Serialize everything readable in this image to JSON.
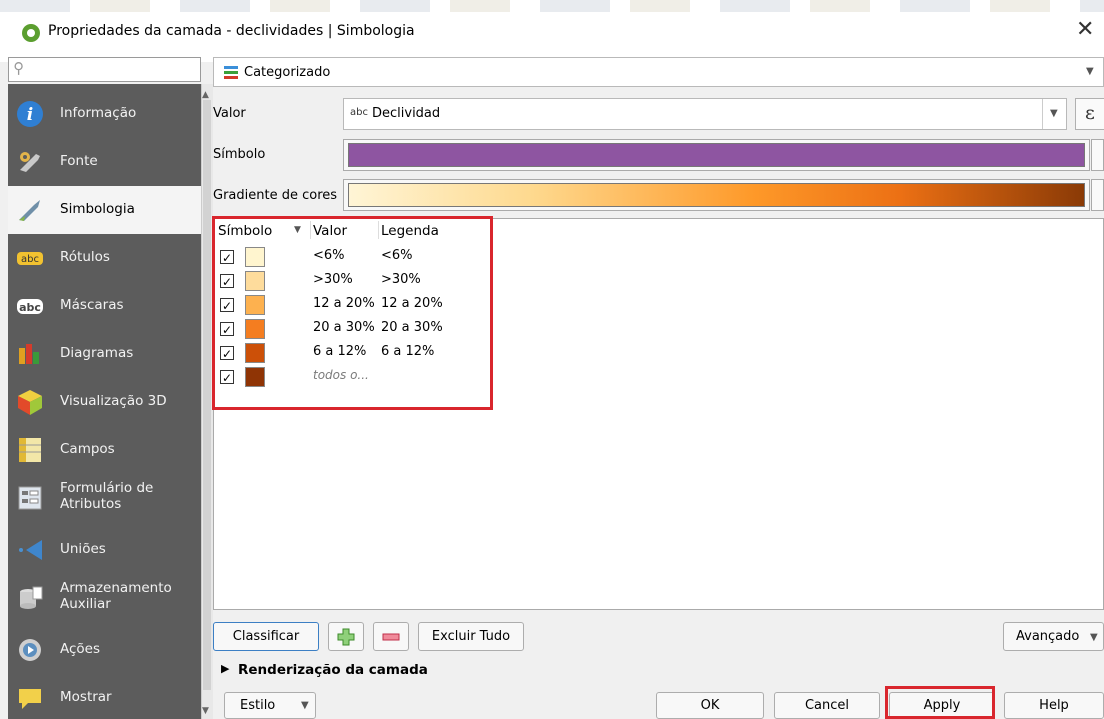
{
  "window": {
    "title": "Propriedades da camada - declividades | Simbologia"
  },
  "sidebar": {
    "search_placeholder": "",
    "items": [
      {
        "label": "Informação",
        "icon": "info-icon"
      },
      {
        "label": "Fonte",
        "icon": "wrench-icon"
      },
      {
        "label": "Simbologia",
        "icon": "paintbrush-icon",
        "active": true
      },
      {
        "label": "Rótulos",
        "icon": "abc-label-icon"
      },
      {
        "label": "Máscaras",
        "icon": "abc-mask-icon"
      },
      {
        "label": "Diagramas",
        "icon": "diagram-icon"
      },
      {
        "label": "Visualização 3D",
        "icon": "cube-icon"
      },
      {
        "label": "Campos",
        "icon": "fields-icon"
      },
      {
        "label": "Formulário de Atributos",
        "line1": "Formulário de",
        "line2": "Atributos",
        "icon": "form-icon"
      },
      {
        "label": "Uniões",
        "icon": "join-icon"
      },
      {
        "label": "Armazenamento Auxiliar",
        "line1": "Armazenamento",
        "line2": "Auxiliar",
        "icon": "storage-icon"
      },
      {
        "label": "Ações",
        "icon": "actions-icon"
      },
      {
        "label": "Mostrar",
        "icon": "speech-bubble-icon"
      }
    ]
  },
  "renderer": {
    "value": "Categorizado"
  },
  "fields": {
    "valor_label": "Valor",
    "valor_abc": "abc",
    "valor_value": "Declividad",
    "simbolo_label": "Símbolo",
    "symbol_color": "#8e55a1",
    "gradiente_label": "Gradiente de cores",
    "ramp_start": "#fff5d6",
    "ramp_end": "#8a3a06"
  },
  "table": {
    "headers": {
      "symbol": "Símbolo",
      "value": "Valor",
      "legend": "Legenda"
    },
    "rows": [
      {
        "checked": "✓",
        "color": "#fff5cf",
        "value": "<6%",
        "legend": "<6%"
      },
      {
        "checked": "✓",
        "color": "#fedc9c",
        "value": ">30%",
        "legend": ">30%"
      },
      {
        "checked": "✓",
        "color": "#fdb14f",
        "value": "12 a 20%",
        "legend": "12 a 20%"
      },
      {
        "checked": "✓",
        "color": "#f47d20",
        "value": "20 a 30%",
        "legend": "20 a 30%"
      },
      {
        "checked": "✓",
        "color": "#cc5008",
        "value": "6 a 12%",
        "legend": "6 a 12%"
      },
      {
        "checked": "✓",
        "color": "#8f3405",
        "value": "todos o...",
        "legend": ""
      }
    ]
  },
  "buttons": {
    "classify": "Classificar",
    "delete_all": "Excluir Tudo",
    "advanced": "Avançado",
    "render_section": "Renderização da camada",
    "style": "Estilo",
    "ok": "OK",
    "cancel": "Cancel",
    "apply": "Apply",
    "help": "Help"
  },
  "colors": {
    "highlight": "#d9262d",
    "sidebar_bg": "#5c5c5c"
  }
}
